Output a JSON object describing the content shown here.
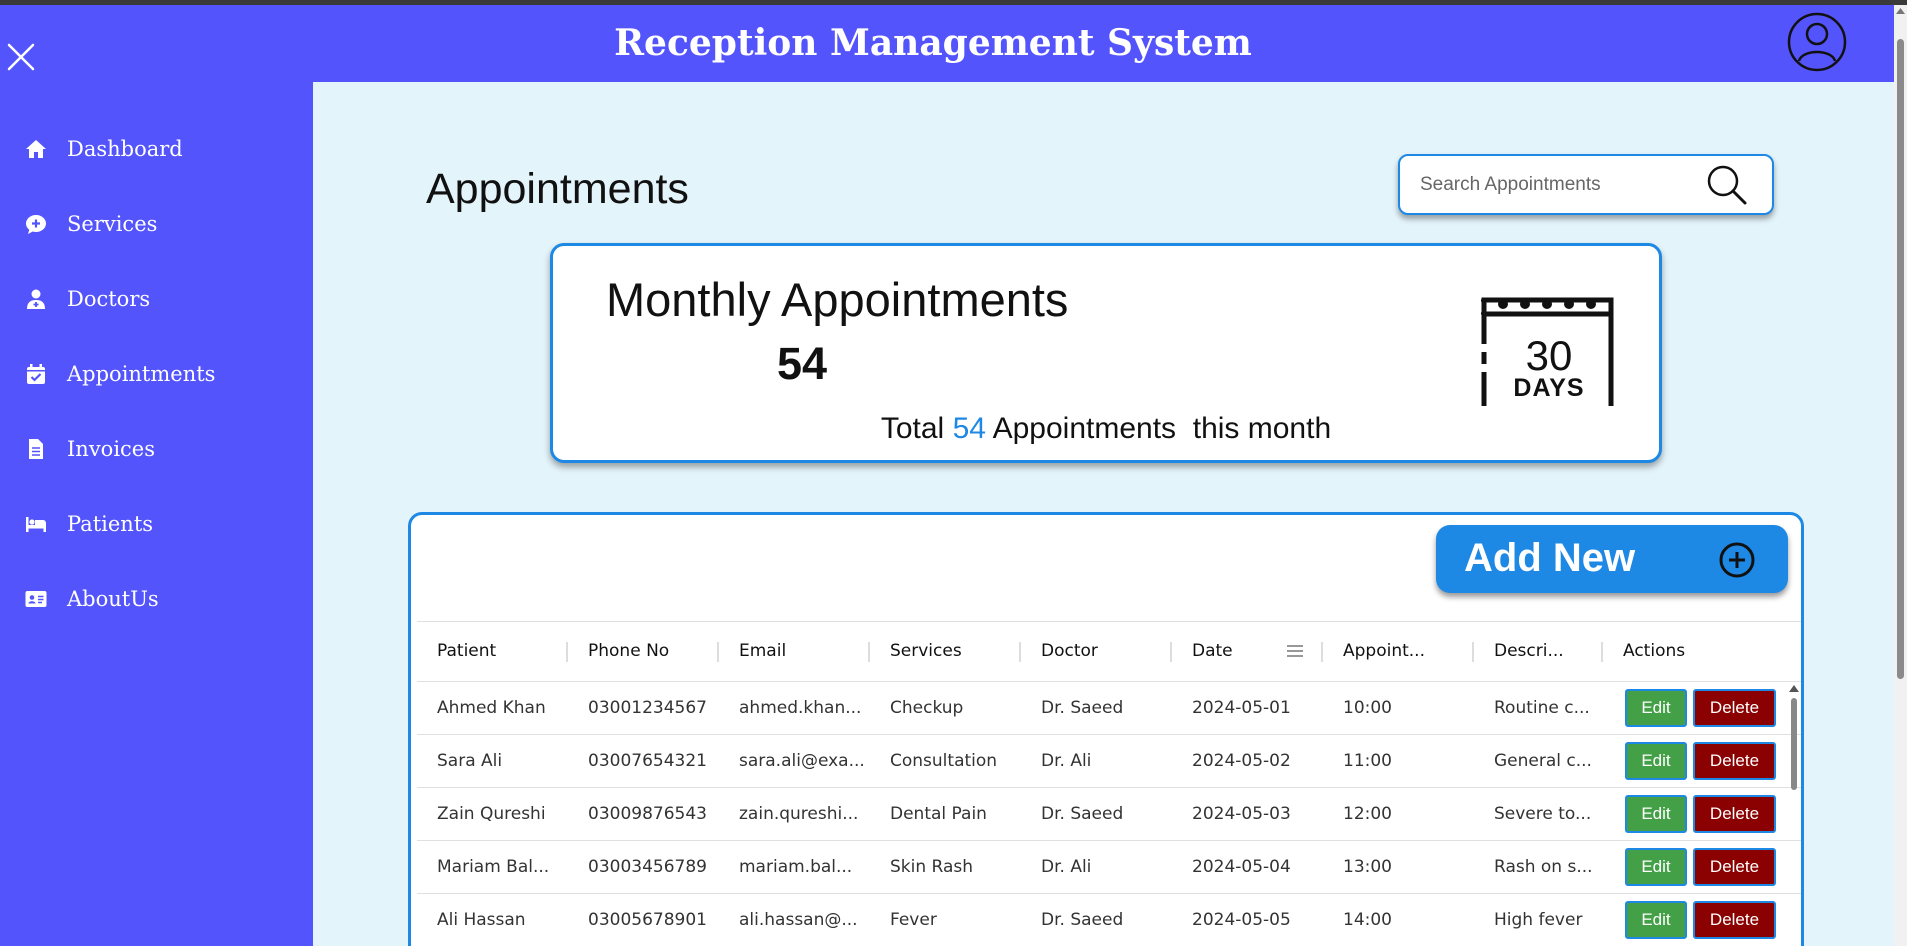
{
  "header": {
    "title": "Reception Management System"
  },
  "sidebar": {
    "items": [
      {
        "label": "Dashboard",
        "icon": "home-icon"
      },
      {
        "label": "Services",
        "icon": "chat-plus-icon"
      },
      {
        "label": "Doctors",
        "icon": "doctor-icon"
      },
      {
        "label": "Appointments",
        "icon": "calendar-check-icon"
      },
      {
        "label": "Invoices",
        "icon": "invoice-icon"
      },
      {
        "label": "Patients",
        "icon": "bed-icon"
      },
      {
        "label": "AboutUs",
        "icon": "id-card-icon"
      }
    ]
  },
  "main": {
    "page_title": "Appointments",
    "search": {
      "placeholder": "Search Appointments",
      "value": ""
    },
    "stat_card": {
      "title": "Monthly Appointments",
      "count": "54",
      "caption_pre": "Total ",
      "caption_value": "54",
      "caption_post": " Appointments  this month",
      "calendar_number": "30",
      "calendar_unit": "DAYS"
    },
    "add_button": {
      "label": "Add New"
    },
    "table": {
      "columns": [
        "Patient",
        "Phone No",
        "Email",
        "Services",
        "Doctor",
        "Date",
        "Appoint...",
        "Descri...",
        "Actions"
      ],
      "rows": [
        [
          "Ahmed Khan",
          "03001234567",
          "ahmed.khan...",
          "Checkup",
          "Dr. Saeed",
          "2024-05-01",
          "10:00",
          "Routine c..."
        ],
        [
          "Sara Ali",
          "03007654321",
          "sara.ali@exa...",
          "Consultation",
          "Dr. Ali",
          "2024-05-02",
          "11:00",
          "General c..."
        ],
        [
          "Zain Qureshi",
          "03009876543",
          "zain.qureshi...",
          "Dental Pain",
          "Dr. Saeed",
          "2024-05-03",
          "12:00",
          "Severe to..."
        ],
        [
          "Mariam Bal...",
          "03003456789",
          "mariam.bal...",
          "Skin Rash",
          "Dr. Ali",
          "2024-05-04",
          "13:00",
          "Rash on s..."
        ],
        [
          "Ali Hassan",
          "03005678901",
          "ali.hassan@...",
          "Fever",
          "Dr. Saeed",
          "2024-05-05",
          "14:00",
          "High fever"
        ]
      ],
      "edit_label": "Edit",
      "delete_label": "Delete"
    }
  },
  "colors": {
    "sidebar": "#5454fc",
    "background": "#e3f4fa",
    "accent": "#1e88e5",
    "edit": "#43a047",
    "delete": "#8b0000"
  }
}
